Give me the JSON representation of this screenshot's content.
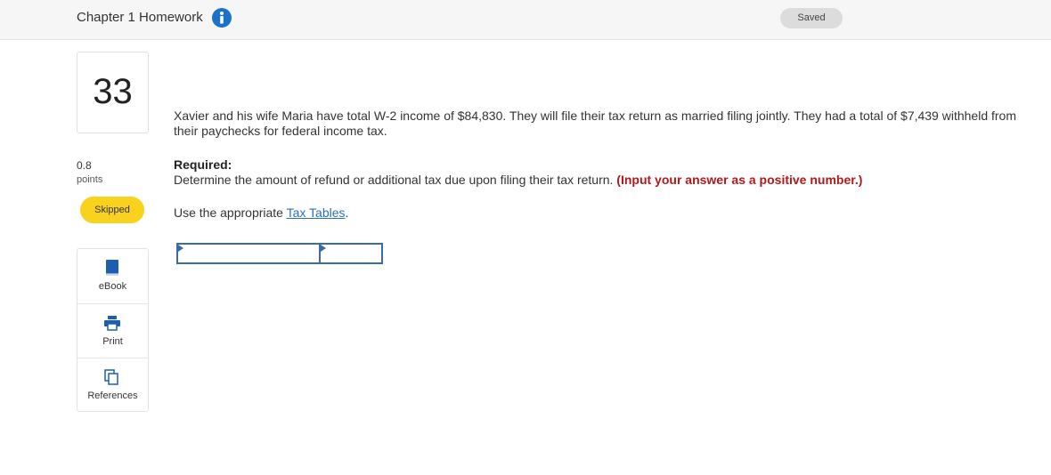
{
  "header": {
    "title": "Chapter 1 Homework",
    "info_icon": "info-icon",
    "status": "Saved"
  },
  "question_meta": {
    "number": "33",
    "points_value": "0.8",
    "points_label": "points",
    "status_badge": "Skipped"
  },
  "tools": [
    {
      "label": "eBook",
      "icon": "book-icon"
    },
    {
      "label": "Print",
      "icon": "printer-icon"
    },
    {
      "label": "References",
      "icon": "references-icon"
    }
  ],
  "content": {
    "question_text": "Xavier and his wife Maria have total W-2 income of $84,830. They will file their tax return as married filing jointly. They had a total of $7,439 withheld from their paychecks for federal income tax.",
    "required_heading": "Required:",
    "required_text": "Determine the amount of refund or additional tax due upon filing their tax return.",
    "required_note": "(Input your answer as a positive number.)",
    "use_prefix": "Use the appropriate",
    "use_link": "Tax Tables",
    "use_suffix": "."
  },
  "answer": {
    "cell1_value": "",
    "cell2_value": ""
  },
  "colors": {
    "accent_blue": "#1a73c8",
    "badge_yellow": "#f8d21c",
    "note_red": "#b0181b",
    "input_border": "#3a6ba6"
  }
}
